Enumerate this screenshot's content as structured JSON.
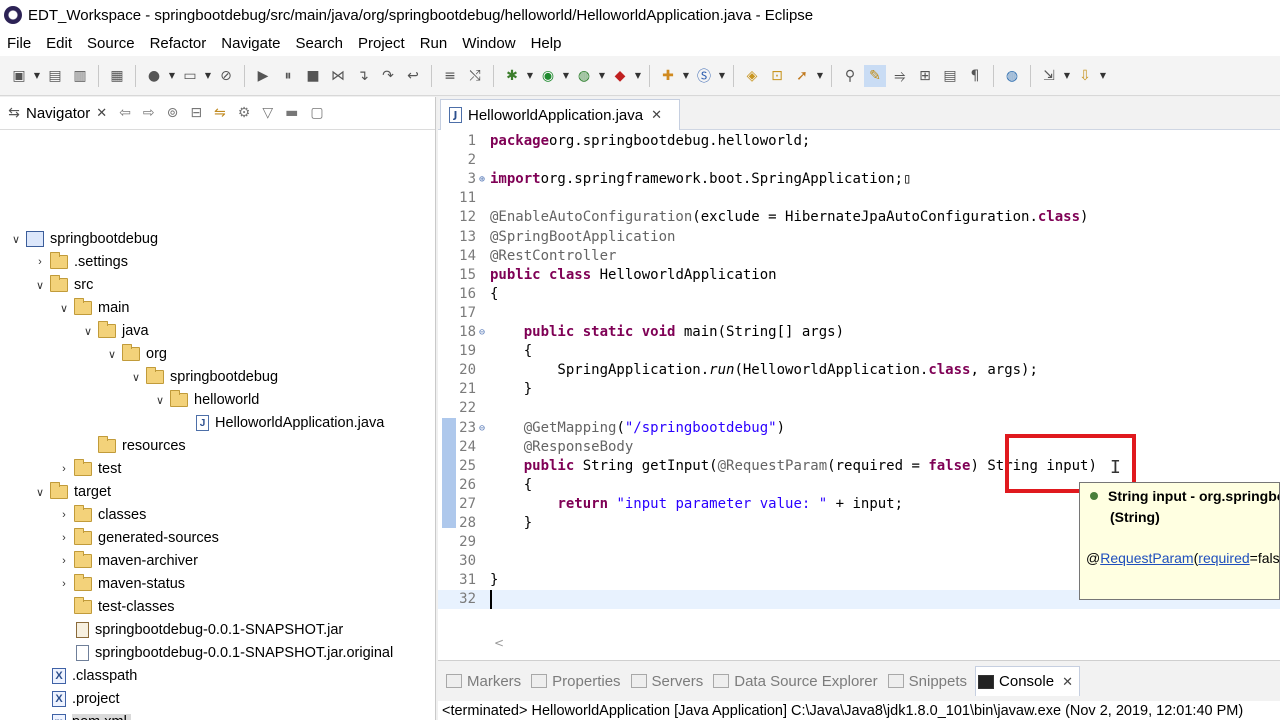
{
  "window": {
    "title": "EDT_Workspace - springbootdebug/src/main/java/org/springbootdebug/helloworld/HelloworldApplication.java - Eclipse"
  },
  "menu": [
    "File",
    "Edit",
    "Source",
    "Refactor",
    "Navigate",
    "Search",
    "Project",
    "Run",
    "Window",
    "Help"
  ],
  "navigator": {
    "tab_label": "Navigator",
    "tree": [
      {
        "label": "springbootdebug",
        "depth": 0,
        "expanded": true,
        "icon": "project-icon"
      },
      {
        "label": ".settings",
        "depth": 1,
        "expanded": false,
        "icon": "folder-icon"
      },
      {
        "label": "src",
        "depth": 1,
        "expanded": true,
        "icon": "folder-icon"
      },
      {
        "label": "main",
        "depth": 2,
        "expanded": true,
        "icon": "folder-icon"
      },
      {
        "label": "java",
        "depth": 3,
        "expanded": true,
        "icon": "folder-icon"
      },
      {
        "label": "org",
        "depth": 4,
        "expanded": true,
        "icon": "folder-icon"
      },
      {
        "label": "springbootdebug",
        "depth": 5,
        "expanded": true,
        "icon": "folder-icon"
      },
      {
        "label": "helloworld",
        "depth": 6,
        "expanded": true,
        "icon": "folder-icon"
      },
      {
        "label": "HelloworldApplication.java",
        "depth": 7,
        "icon": "java-file-icon"
      },
      {
        "label": "resources",
        "depth": 3,
        "icon": "folder-icon"
      },
      {
        "label": "test",
        "depth": 2,
        "expanded": false,
        "icon": "folder-icon"
      },
      {
        "label": "target",
        "depth": 1,
        "expanded": true,
        "icon": "folder-icon"
      },
      {
        "label": "classes",
        "depth": 2,
        "expanded": false,
        "icon": "folder-icon"
      },
      {
        "label": "generated-sources",
        "depth": 2,
        "expanded": false,
        "icon": "folder-icon"
      },
      {
        "label": "maven-archiver",
        "depth": 2,
        "expanded": false,
        "icon": "folder-icon"
      },
      {
        "label": "maven-status",
        "depth": 2,
        "expanded": false,
        "icon": "folder-icon"
      },
      {
        "label": "test-classes",
        "depth": 2,
        "icon": "folder-icon"
      },
      {
        "label": "springbootdebug-0.0.1-SNAPSHOT.jar",
        "depth": 2,
        "icon": "jar-file-icon"
      },
      {
        "label": "springbootdebug-0.0.1-SNAPSHOT.jar.original",
        "depth": 2,
        "icon": "file-icon"
      },
      {
        "label": ".classpath",
        "depth": 1,
        "icon": "xml-file-icon"
      },
      {
        "label": ".project",
        "depth": 1,
        "icon": "xml-file-icon"
      },
      {
        "label": "pom.xml",
        "depth": 1,
        "icon": "maven-file-icon",
        "selected": true
      }
    ]
  },
  "editor": {
    "tab_label": "HelloworldApplication.java",
    "lines": [
      {
        "n": "1",
        "fold": "",
        "parts": [
          [
            "kw",
            "package"
          ],
          [
            "",
            "org.springbootdebug.helloworld;"
          ]
        ]
      },
      {
        "n": "2",
        "fold": "",
        "parts": []
      },
      {
        "n": "3",
        "fold": "⊕",
        "parts": [
          [
            "kw",
            "import"
          ],
          [
            "",
            "org.springframework.boot.SpringApplication;▯"
          ]
        ]
      },
      {
        "n": "11",
        "fold": "",
        "parts": []
      },
      {
        "n": "12",
        "fold": "",
        "parts": [
          [
            "ann",
            "@EnableAutoConfiguration"
          ],
          [
            "",
            "(exclude = HibernateJpaAutoConfiguration."
          ],
          [
            "kw",
            "class"
          ],
          [
            "",
            ")"
          ]
        ]
      },
      {
        "n": "13",
        "fold": "",
        "parts": [
          [
            "ann",
            "@SpringBootApplication"
          ]
        ]
      },
      {
        "n": "14",
        "fold": "",
        "parts": [
          [
            "ann",
            "@RestController"
          ]
        ]
      },
      {
        "n": "15",
        "fold": "",
        "parts": [
          [
            "kw",
            "public class"
          ],
          [
            "",
            " HelloworldApplication"
          ]
        ]
      },
      {
        "n": "16",
        "fold": "",
        "parts": [
          [
            "",
            "{"
          ]
        ]
      },
      {
        "n": "17",
        "fold": "",
        "parts": []
      },
      {
        "n": "18",
        "fold": "⊖",
        "parts": [
          [
            "",
            "    "
          ],
          [
            "kw",
            "public static void"
          ],
          [
            "",
            " main(String[] args)"
          ]
        ]
      },
      {
        "n": "19",
        "fold": "",
        "parts": [
          [
            "",
            "    {"
          ]
        ]
      },
      {
        "n": "20",
        "fold": "",
        "parts": [
          [
            "",
            "        SpringApplication."
          ],
          [
            "it",
            "run"
          ],
          [
            "",
            "(HelloworldApplication."
          ],
          [
            "kw",
            "class"
          ],
          [
            "",
            ", args);"
          ]
        ]
      },
      {
        "n": "21",
        "fold": "",
        "parts": [
          [
            "",
            "    }"
          ]
        ]
      },
      {
        "n": "22",
        "fold": "",
        "parts": []
      },
      {
        "n": "23",
        "fold": "⊖",
        "parts": [
          [
            "",
            "    "
          ],
          [
            "ann",
            "@GetMapping"
          ],
          [
            "",
            "("
          ],
          [
            "str",
            "\"/springbootdebug\""
          ],
          [
            "",
            ")"
          ]
        ]
      },
      {
        "n": "24",
        "fold": "",
        "parts": [
          [
            "",
            "    "
          ],
          [
            "ann",
            "@ResponseBody"
          ]
        ]
      },
      {
        "n": "25",
        "fold": "",
        "parts": [
          [
            "",
            "    "
          ],
          [
            "kw",
            "public"
          ],
          [
            "",
            " String getInput("
          ],
          [
            "ann",
            "@RequestParam"
          ],
          [
            "",
            "(required = "
          ],
          [
            "kw",
            "false"
          ],
          [
            "",
            ") String input)"
          ]
        ]
      },
      {
        "n": "26",
        "fold": "",
        "parts": [
          [
            "",
            "    {"
          ]
        ]
      },
      {
        "n": "27",
        "fold": "",
        "parts": [
          [
            "",
            "        "
          ],
          [
            "kw",
            "return"
          ],
          [
            "",
            " "
          ],
          [
            "str",
            "\"input parameter value: \""
          ],
          [
            "",
            " + input;"
          ]
        ]
      },
      {
        "n": "28",
        "fold": "",
        "parts": [
          [
            "",
            "    }"
          ]
        ]
      },
      {
        "n": "29",
        "fold": "",
        "parts": []
      },
      {
        "n": "30",
        "fold": "",
        "parts": []
      },
      {
        "n": "31",
        "fold": "",
        "parts": [
          [
            "",
            "}"
          ]
        ]
      },
      {
        "n": "32",
        "fold": "",
        "parts": []
      }
    ]
  },
  "tooltip": {
    "title": "String input - org.springbootdebug.helloworld.HelloworldApplication.getInput(String)",
    "type": "(String)",
    "body_prefix": "@",
    "link1": "RequestParam",
    "body_mid": "(",
    "link2": "required",
    "body_suffix": "=false)"
  },
  "bottom_panel": {
    "tabs": [
      {
        "label": "Markers",
        "icon": "markers-icon"
      },
      {
        "label": "Properties",
        "icon": "properties-icon"
      },
      {
        "label": "Servers",
        "icon": "servers-icon"
      },
      {
        "label": "Data Source Explorer",
        "icon": "database-icon"
      },
      {
        "label": "Snippets",
        "icon": "snippets-icon"
      },
      {
        "label": "Console",
        "icon": "console-icon",
        "active": true
      }
    ],
    "status": "<terminated> HelloworldApplication [Java Application] C:\\Java\\Java8\\jdk1.8.0_101\\bin\\javaw.exe (Nov 2, 2019, 12:01:40 PM)"
  }
}
